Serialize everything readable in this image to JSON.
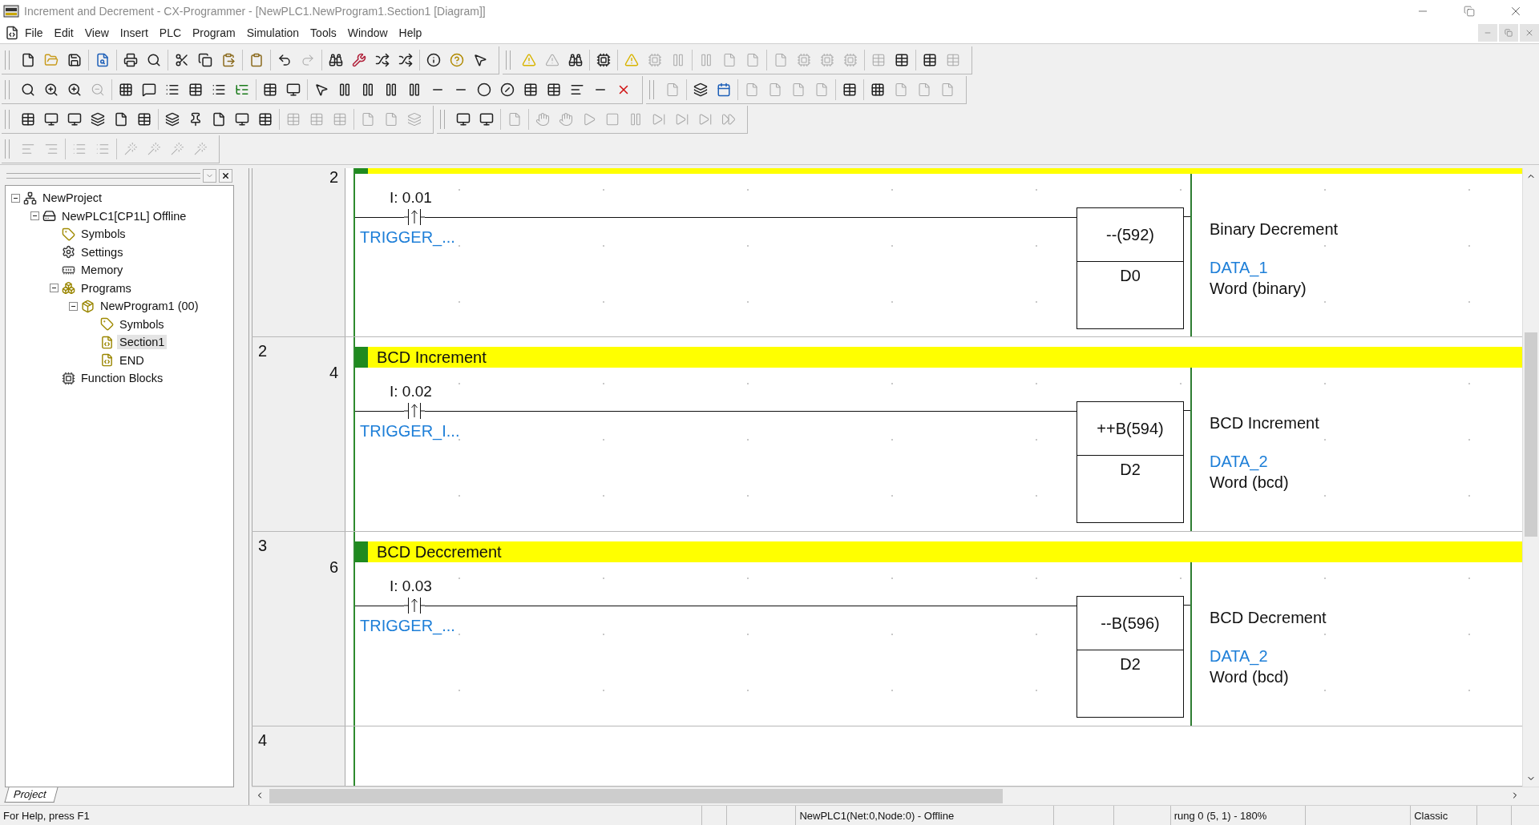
{
  "window": {
    "title": "Increment and Decrement - CX-Programmer - [NewPLC1.NewProgram1.Section1 [Diagram]]"
  },
  "menu": [
    "File",
    "Edit",
    "View",
    "Insert",
    "PLC",
    "Program",
    "Simulation",
    "Tools",
    "Window",
    "Help"
  ],
  "toolbar_rows": [
    [
      {
        "groups": [
          [
            {
              "disabled": false
            },
            {
              "disabled": false
            },
            {
              "disabled": false
            }
          ],
          [
            {
              "disabled": false
            }
          ],
          [
            {
              "disabled": false
            },
            {
              "disabled": false
            }
          ],
          [
            {
              "disabled": false
            },
            {
              "disabled": false
            },
            {
              "disabled": false
            }
          ],
          [
            {
              "disabled": false
            }
          ],
          [
            {
              "disabled": false
            },
            {
              "disabled": true
            }
          ],
          [
            {
              "disabled": false
            },
            {
              "disabled": false
            },
            {
              "disabled": false
            },
            {
              "disabled": false
            }
          ],
          [
            {
              "disabled": false
            },
            {
              "disabled": false
            },
            {
              "disabled": false
            }
          ]
        ]
      },
      {
        "groups": [
          [
            {
              "disabled": false
            },
            {
              "disabled": true
            },
            {
              "disabled": false
            }
          ],
          [
            {
              "disabled": false
            }
          ],
          [
            {
              "disabled": false
            },
            {
              "disabled": true
            },
            {
              "disabled": true
            }
          ],
          [
            {
              "disabled": true
            },
            {
              "disabled": true
            },
            {
              "disabled": true
            }
          ],
          [
            {
              "disabled": true
            },
            {
              "disabled": true
            },
            {
              "disabled": true
            },
            {
              "disabled": true
            }
          ],
          [
            {
              "disabled": true
            },
            {
              "disabled": false
            }
          ],
          [
            {
              "disabled": false
            },
            {
              "disabled": true
            }
          ]
        ]
      }
    ],
    [
      {
        "groups": [
          [
            {
              "disabled": false
            },
            {
              "disabled": false
            },
            {
              "disabled": false
            },
            {
              "disabled": true
            }
          ],
          [
            {
              "disabled": false
            },
            {
              "disabled": false
            },
            {
              "disabled": false
            },
            {
              "disabled": false
            },
            {
              "disabled": false
            },
            {
              "disabled": false
            }
          ],
          [
            {
              "disabled": false
            },
            {
              "disabled": false
            }
          ],
          [
            {
              "disabled": false
            },
            {
              "disabled": false
            },
            {
              "disabled": false
            },
            {
              "disabled": false
            },
            {
              "disabled": false
            },
            {
              "disabled": false
            },
            {
              "disabled": false
            },
            {
              "disabled": false
            },
            {
              "disabled": false
            },
            {
              "disabled": false
            },
            {
              "disabled": false
            },
            {
              "disabled": false
            },
            {
              "disabled": false
            },
            {
              "disabled": false
            }
          ]
        ]
      },
      {
        "groups": [
          [
            {
              "disabled": true
            }
          ],
          [
            {
              "disabled": false
            },
            {
              "disabled": false
            }
          ],
          [
            {
              "disabled": true
            },
            {
              "disabled": true
            },
            {
              "disabled": true
            },
            {
              "disabled": true
            }
          ],
          [
            {
              "disabled": false
            }
          ],
          [
            {
              "disabled": false
            },
            {
              "disabled": true
            },
            {
              "disabled": true
            },
            {
              "disabled": true
            }
          ]
        ]
      }
    ],
    [
      {
        "groups": [
          [
            {
              "disabled": false
            },
            {
              "disabled": false
            },
            {
              "disabled": false
            },
            {
              "disabled": false
            },
            {
              "disabled": false
            },
            {
              "disabled": false
            }
          ],
          [
            {
              "disabled": false
            },
            {
              "disabled": false
            },
            {
              "disabled": false
            },
            {
              "disabled": false
            },
            {
              "disabled": false
            }
          ],
          [
            {
              "disabled": true
            },
            {
              "disabled": true
            },
            {
              "disabled": true
            }
          ],
          [
            {
              "disabled": true
            },
            {
              "disabled": true
            },
            {
              "disabled": true
            }
          ]
        ]
      },
      {
        "groups": [
          [
            {
              "disabled": false
            },
            {
              "disabled": false
            }
          ],
          [
            {
              "disabled": true
            }
          ],
          [
            {
              "disabled": true
            },
            {
              "disabled": true
            },
            {
              "disabled": true
            },
            {
              "disabled": true
            },
            {
              "disabled": true
            },
            {
              "disabled": true
            },
            {
              "disabled": true
            },
            {
              "disabled": true
            },
            {
              "disabled": true
            }
          ]
        ]
      }
    ],
    [
      {
        "groups": [
          [
            {
              "disabled": true
            },
            {
              "disabled": true
            }
          ],
          [
            {
              "disabled": true
            },
            {
              "disabled": true
            }
          ],
          [
            {
              "disabled": true
            },
            {
              "disabled": true
            },
            {
              "disabled": true
            },
            {
              "disabled": true
            }
          ]
        ]
      }
    ]
  ],
  "tree": [
    {
      "label": "NewProject",
      "kind": "project",
      "expanded": true,
      "selected": false,
      "children": [
        {
          "label": "NewPLC1[CP1L] Offline",
          "kind": "plc",
          "expanded": true,
          "selected": false,
          "children": [
            {
              "label": "Symbols",
              "kind": "symbols",
              "selected": false
            },
            {
              "label": "Settings",
              "kind": "settings",
              "selected": false
            },
            {
              "label": "Memory",
              "kind": "memory",
              "selected": false
            },
            {
              "label": "Programs",
              "kind": "programs",
              "expanded": true,
              "selected": false,
              "children": [
                {
                  "label": "NewProgram1 (00)",
                  "kind": "program",
                  "expanded": true,
                  "selected": false,
                  "children": [
                    {
                      "label": "Symbols",
                      "kind": "symbols",
                      "selected": false
                    },
                    {
                      "label": "Section1",
                      "kind": "section",
                      "selected": true
                    },
                    {
                      "label": "END",
                      "kind": "section",
                      "selected": false
                    }
                  ]
                }
              ]
            },
            {
              "label": "Function Blocks",
              "kind": "function_blocks",
              "selected": false
            }
          ]
        }
      ]
    }
  ],
  "panel_tab": "Project",
  "rungs": [
    {
      "kind": "cut",
      "step": "2",
      "contact_address": "I: 0.01",
      "contact_symbol": "TRIGGER_...",
      "instruction": "--(592)",
      "operand": "D0",
      "description": "Binary Decrement",
      "operand_symbol": "DATA_1",
      "data_type": "Word (binary)"
    },
    {
      "kind": "full",
      "number": "2",
      "step": "4",
      "comment": "BCD Increment",
      "contact_address": "I: 0.02",
      "contact_symbol": "TRIGGER_I...",
      "instruction": "++B(594)",
      "operand": "D2",
      "description": "BCD Increment",
      "operand_symbol": "DATA_2",
      "data_type": "Word (bcd)"
    },
    {
      "kind": "full",
      "number": "3",
      "step": "6",
      "comment": "BCD Deccrement",
      "contact_address": "I: 0.03",
      "contact_symbol": "TRIGGER_...",
      "instruction": "--B(596)",
      "operand": "D2",
      "description": "BCD Decrement",
      "operand_symbol": "DATA_2",
      "data_type": "Word (bcd)"
    },
    {
      "kind": "empty",
      "number": "4"
    }
  ],
  "status_bar": {
    "help": "For Help, press F1",
    "connection": "NewPLC1(Net:0,Node:0) - Offline",
    "position": "rung 0 (5, 1) - 180%",
    "mode": "Classic"
  }
}
